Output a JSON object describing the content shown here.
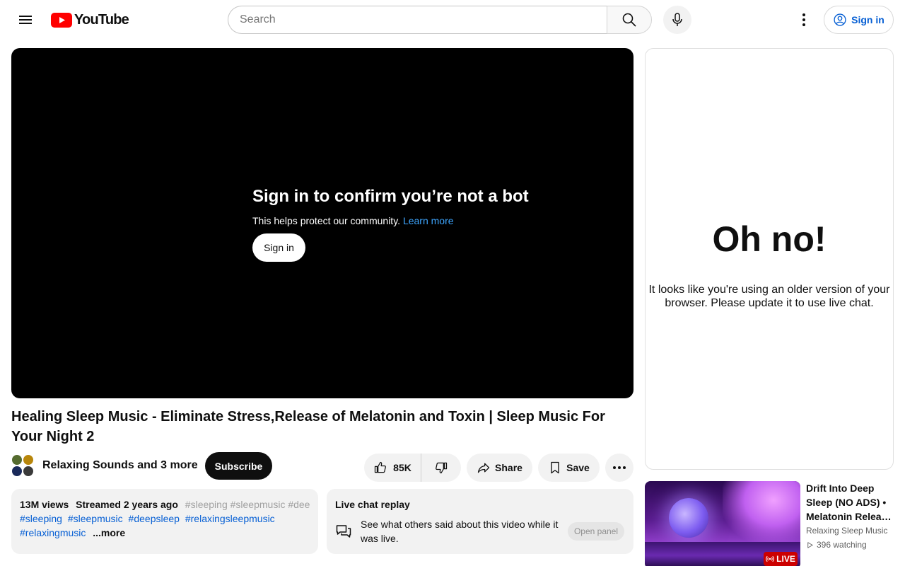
{
  "header": {
    "logo_text": "YouTube",
    "search_placeholder": "Search",
    "sign_in_label": "Sign in"
  },
  "player": {
    "bot_title": "Sign in to confirm you’re not a bot",
    "bot_desc": "This helps protect our community.",
    "learn_more": "Learn more",
    "sign_in_label": "Sign in"
  },
  "video": {
    "title": "Healing Sleep Music - Eliminate Stress,Release of Melatonin and Toxin | Sleep Music For Your Night 2",
    "channel_name": "Relaxing Sounds and 3 more",
    "subscribe_label": "Subscribe",
    "like_count": "85K",
    "share_label": "Share",
    "save_label": "Save"
  },
  "description": {
    "views": "13M views",
    "date": "Streamed 2 years ago",
    "inline_tags": "#sleeping #sleepmusic #deep",
    "tags_line2": [
      "#sleeping",
      "#sleepmusic",
      "#deepsleep",
      "#relaxingsleepmusic"
    ],
    "tags_line3": [
      "#relaxingmusic"
    ],
    "more_label": "...more"
  },
  "chat_replay": {
    "title": "Live chat replay",
    "text": "See what others said about this video while it was live.",
    "open_panel_label": "Open panel"
  },
  "chat_panel": {
    "heading": "Oh no!",
    "message": "It looks like you're using an older version of your browser. Please update it to use live chat."
  },
  "recommendation": {
    "title_lines": [
      "Drift Into Deep",
      "Sleep (NO ADS) •",
      "Melatonin Releas…"
    ],
    "channel": "Relaxing Sleep Music",
    "watching": "396 watching",
    "live_badge": "LIVE"
  },
  "colors": {
    "brand_red": "#ff0000",
    "link_blue": "#065fd4",
    "learn_more_blue": "#3ea6ff",
    "live_red": "#cc0000"
  }
}
